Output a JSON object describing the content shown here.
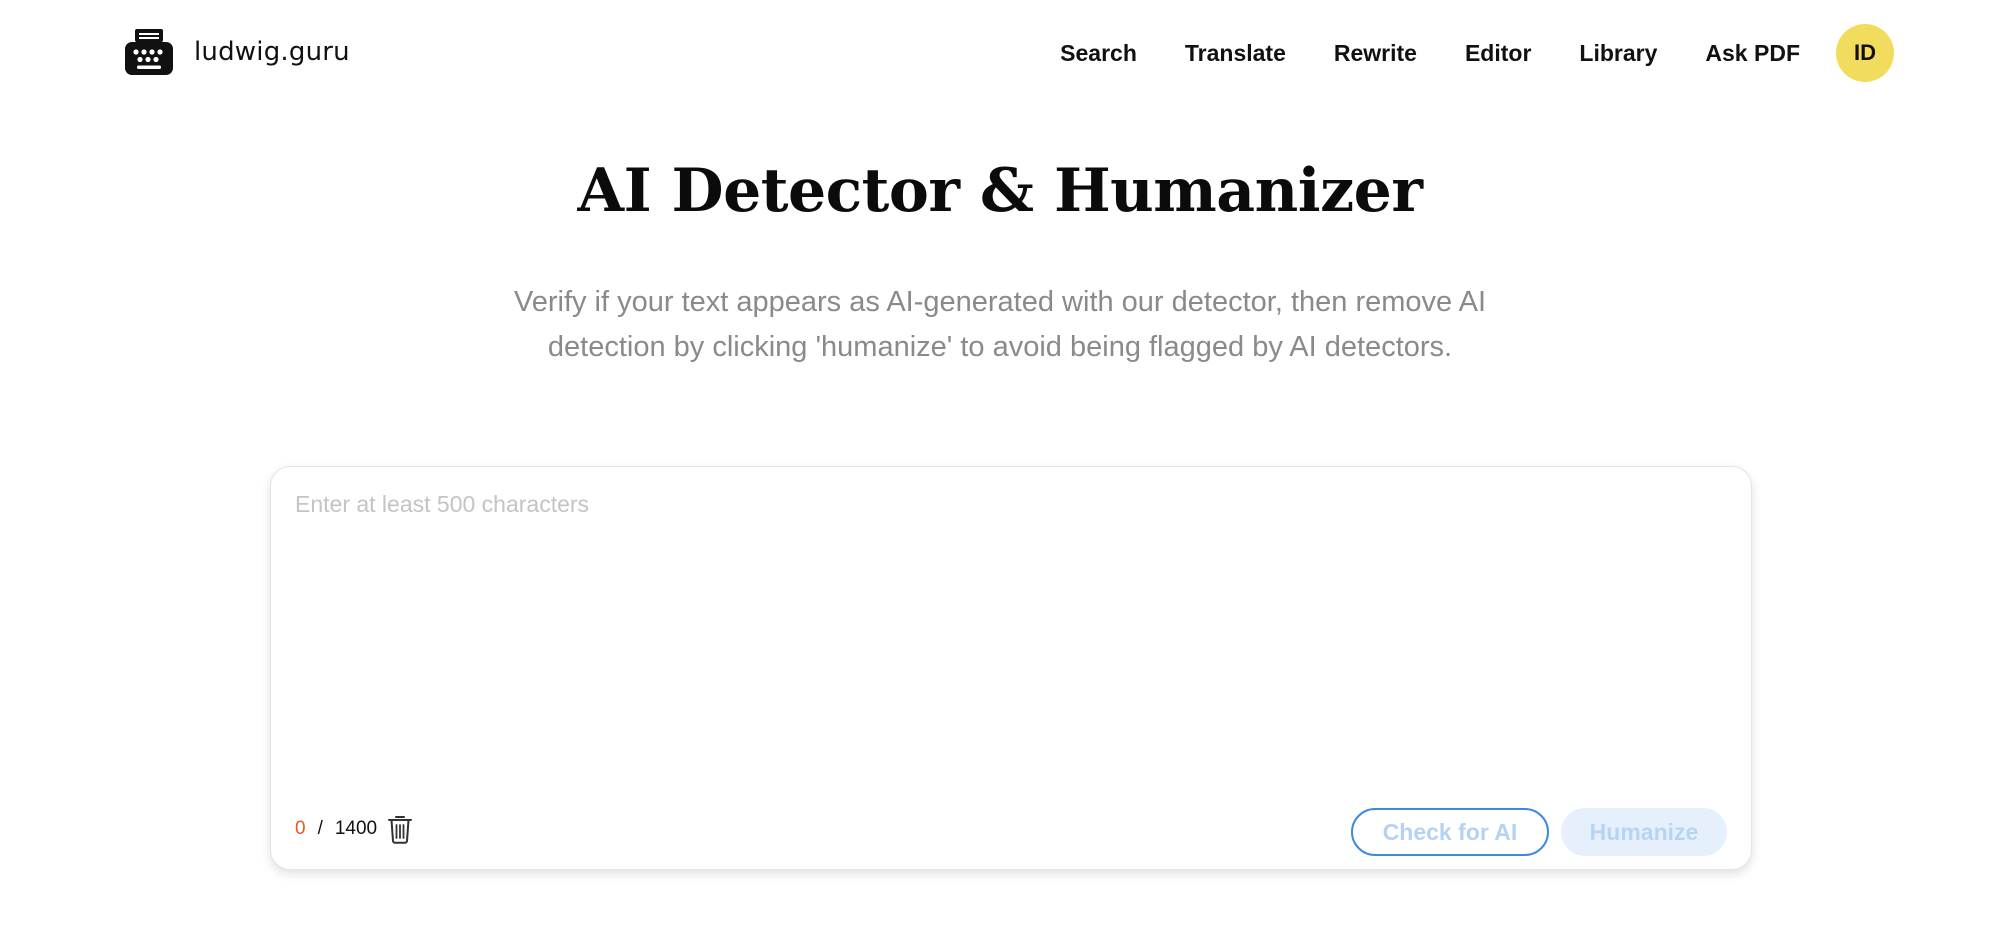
{
  "header": {
    "brand": "ludwig.guru",
    "logo_icon": "typewriter-icon",
    "nav": [
      {
        "label": "Search"
      },
      {
        "label": "Translate"
      },
      {
        "label": "Rewrite"
      },
      {
        "label": "Editor"
      },
      {
        "label": "Library"
      },
      {
        "label": "Ask PDF"
      }
    ],
    "avatar_initials": "ID"
  },
  "hero": {
    "title": "AI Detector & Humanizer",
    "subtitle": "Verify if your text appears as AI-generated with our detector, then remove AI detection by clicking 'humanize' to avoid being flagged by AI detectors."
  },
  "editor": {
    "value": "",
    "placeholder": "Enter at least 500 characters",
    "char_count": "0",
    "separator": "/",
    "char_limit": "1400",
    "clear_icon": "trash-icon",
    "check_label": "Check for AI",
    "humanize_label": "Humanize"
  },
  "colors": {
    "avatar_bg": "#f2dc5d",
    "count_highlight": "#e8582b",
    "accent_blue": "#3f8ae0",
    "humanize_bg": "#e6f0fc",
    "subtitle_text": "#8a8a8a"
  }
}
